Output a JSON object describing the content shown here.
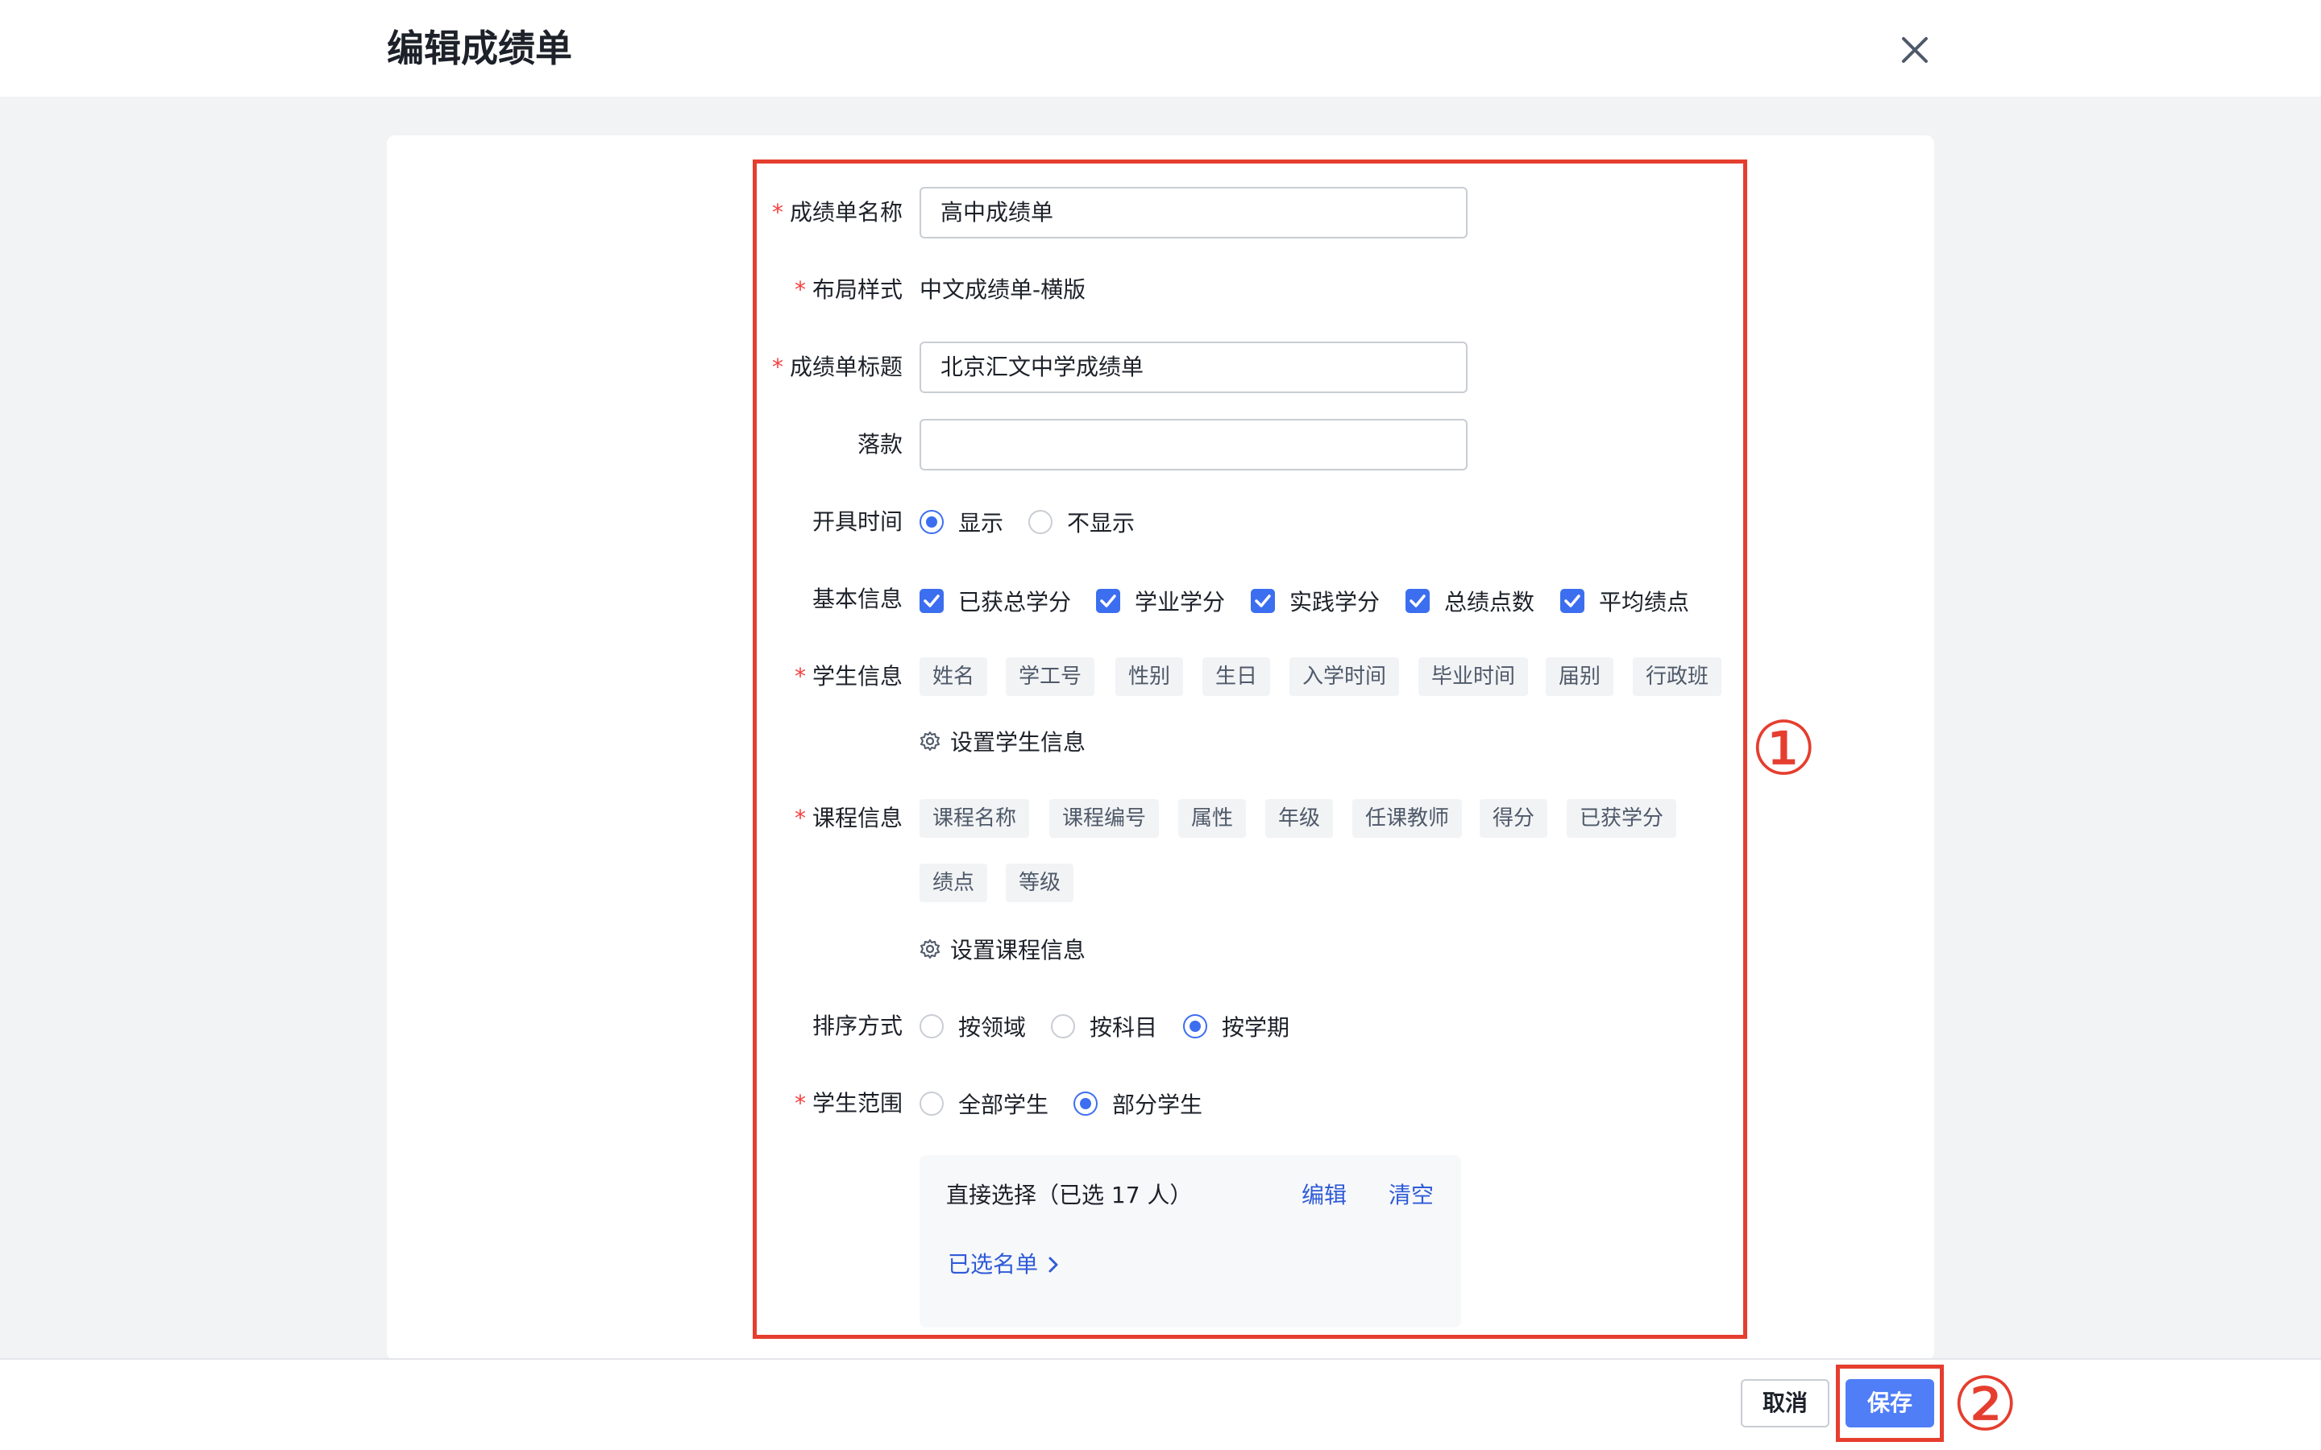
{
  "header": {
    "title": "编辑成绩单"
  },
  "form": {
    "report_name": {
      "label": "成绩单名称",
      "value": "高中成绩单",
      "required": true
    },
    "layout_style": {
      "label": "布局样式",
      "value": "中文成绩单-横版",
      "required": true
    },
    "report_title": {
      "label": "成绩单标题",
      "value": "北京汇文中学成绩单",
      "required": true
    },
    "signature": {
      "label": "落款",
      "value": ""
    },
    "issue_time": {
      "label": "开具时间",
      "options": [
        "显示",
        "不显示"
      ],
      "selected": "显示"
    },
    "basic_info": {
      "label": "基本信息",
      "options": [
        "已获总学分",
        "学业学分",
        "实践学分",
        "总绩点数",
        "平均绩点"
      ],
      "checked": [
        true,
        true,
        true,
        true,
        true
      ]
    },
    "student_info": {
      "label": "学生信息",
      "required": true,
      "tags": [
        "姓名",
        "学工号",
        "性别",
        "生日",
        "入学时间",
        "毕业时间",
        "届别",
        "行政班"
      ],
      "setting_link": "设置学生信息"
    },
    "course_info": {
      "label": "课程信息",
      "required": true,
      "tags": [
        "课程名称",
        "课程编号",
        "属性",
        "年级",
        "任课教师",
        "得分",
        "已获学分",
        "绩点",
        "等级"
      ],
      "setting_link": "设置课程信息"
    },
    "sort_method": {
      "label": "排序方式",
      "options": [
        "按领域",
        "按科目",
        "按学期"
      ],
      "selected": "按学期"
    },
    "student_scope": {
      "label": "学生范围",
      "required": true,
      "options": [
        "全部学生",
        "部分学生"
      ],
      "selected": "部分学生"
    },
    "selection_panel": {
      "text": "直接选择（已选 17 人）",
      "edit": "编辑",
      "clear": "清空",
      "list_link": "已选名单"
    }
  },
  "annotations": {
    "marker_1": "①",
    "marker_2": "②"
  },
  "footer": {
    "cancel": "取消",
    "save": "保存"
  },
  "colors": {
    "primary": "#4f7ef7",
    "annotation": "#e53e2f",
    "required": "#f53f3f"
  }
}
